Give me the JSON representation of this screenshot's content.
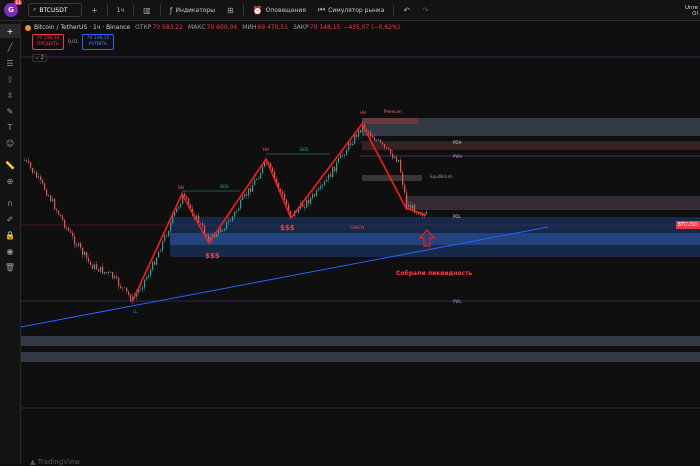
{
  "topbar": {
    "logo_letter": "G",
    "logo_badge": "11",
    "symbol": "BTCUSDT",
    "add_icon": "+",
    "interval": "1ч",
    "indicators": "Индикаторы",
    "alerts": "Оповещения",
    "replay": "Симулятор рынка",
    "unreg_line1": "Unre",
    "unreg_line2": "Ol"
  },
  "legend": {
    "pair": "Bitcoin / TetherUS · 1ч · Binance",
    "open_label": "ОТКР",
    "open": "70 583,22",
    "high_label": "МАКС",
    "high": "70 600,04",
    "low_label": "МИН",
    "low": "69 470,51",
    "close_label": "ЗАКР",
    "close": "70 148,15",
    "change": "−435,07 (−0,62%)"
  },
  "trade": {
    "sell_price": "70 148,14",
    "sell_label": "ПРОДАТЬ",
    "spread": "0,01",
    "buy_price": "70 148,15",
    "buy_label": "КУПИТЬ"
  },
  "collapse_count": "2",
  "price_tag": "BTCUSD",
  "annotations": {
    "liquidity_text": "Собрали ликвидность",
    "ssl1": "$$$",
    "ssl2": "$$$",
    "pdh": "PDH",
    "pwh": "PWH",
    "pdl": "PDL",
    "pwl": "PWL",
    "equilibrium": "Equilibrium",
    "bos1": "BOS",
    "bos2": "BOS",
    "hh1": "HH",
    "hh2": "HH",
    "ll": "LL",
    "premium": "Premium",
    "choch": "CHoCH"
  },
  "footer": {
    "brand": "TradingView"
  },
  "colors": {
    "bull": "#26a69a",
    "bear": "#ef5350",
    "zigzag": "#ff1a1a",
    "trendline": "#2962ff",
    "red_text": "#ff3b3b"
  },
  "icons": [
    "cross-icon",
    "trendline-icon",
    "fib-icon",
    "pattern-icon",
    "measure-icon",
    "brush-icon",
    "text-icon",
    "emoji-icon",
    "ruler-icon",
    "zoom-icon",
    "magnet-icon",
    "lock-icon",
    "eye-icon",
    "trash-icon"
  ]
}
